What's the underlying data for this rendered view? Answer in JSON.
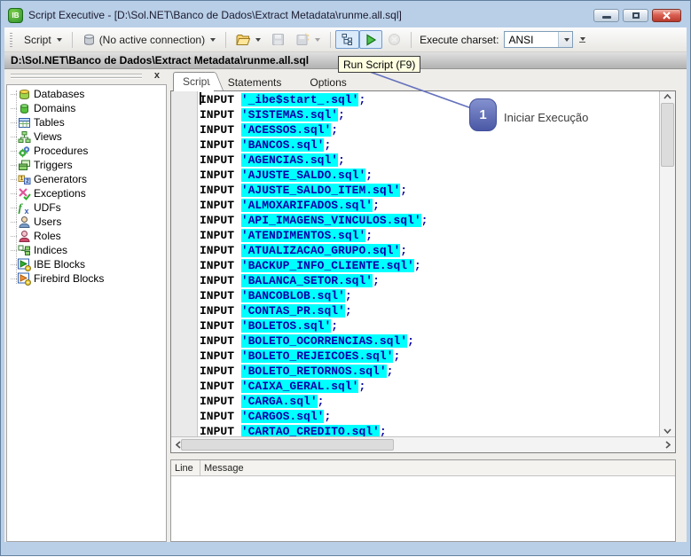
{
  "window": {
    "title": "Script Executive - [D:\\Sol.NET\\Banco de Dados\\Extract Metadata\\runme.all.sql]",
    "icon_text": "IB"
  },
  "toolbar": {
    "script_button": "Script",
    "connection": "(No active connection)",
    "execute_charset_label": "Execute charset:",
    "charset_value": "ANSI",
    "run_tooltip": "Run Script (F9)",
    "icons": [
      "database-icon",
      "open-folder-icon",
      "save-icon",
      "save-all-icon",
      "script-structure-icon",
      "run-icon",
      "stop-icon"
    ]
  },
  "pathbar": {
    "path": "D:\\Sol.NET\\Banco de Dados\\Extract Metadata\\runme.all.sql"
  },
  "sidebar": {
    "items": [
      {
        "label": "Databases",
        "icon": "databases-icon"
      },
      {
        "label": "Domains",
        "icon": "domain-icon"
      },
      {
        "label": "Tables",
        "icon": "table-icon"
      },
      {
        "label": "Views",
        "icon": "view-icon"
      },
      {
        "label": "Procedures",
        "icon": "procedure-gear-icon"
      },
      {
        "label": "Triggers",
        "icon": "trigger-icon"
      },
      {
        "label": "Generators",
        "icon": "generator-icon"
      },
      {
        "label": "Exceptions",
        "icon": "exception-icon"
      },
      {
        "label": "UDFs",
        "icon": "udf-fx-icon"
      },
      {
        "label": "Users",
        "icon": "user-icon"
      },
      {
        "label": "Roles",
        "icon": "role-icon"
      },
      {
        "label": "Indices",
        "icon": "index-icon"
      },
      {
        "label": "IBE Blocks",
        "icon": "ibe-block-icon"
      },
      {
        "label": "Firebird Blocks",
        "icon": "firebird-block-icon"
      }
    ]
  },
  "tabs": [
    {
      "label": "Script",
      "active": true
    },
    {
      "label": "Statements",
      "active": false
    },
    {
      "label": "Options",
      "active": false
    }
  ],
  "editor": {
    "keyword": "INPUT",
    "terminator": ";",
    "lines": [
      "'_ibe$start_.sql'",
      "'SISTEMAS.sql'",
      "'ACESSOS.sql'",
      "'BANCOS.sql'",
      "'AGENCIAS.sql'",
      "'AJUSTE_SALDO.sql'",
      "'AJUSTE_SALDO_ITEM.sql'",
      "'ALMOXARIFADOS.sql'",
      "'API_IMAGENS_VINCULOS.sql'",
      "'ATENDIMENTOS.sql'",
      "'ATUALIZACAO_GRUPO.sql'",
      "'BACKUP_INFO_CLIENTE.sql'",
      "'BALANCA_SETOR.sql'",
      "'BANCOBLOB.sql'",
      "'CONTAS_PR.sql'",
      "'BOLETOS.sql'",
      "'BOLETO_OCORRENCIAS.sql'",
      "'BOLETO_REJEICOES.sql'",
      "'BOLETO_RETORNOS.sql'",
      "'CAIXA_GERAL.sql'",
      "'CARGA.sql'",
      "'CARGOS.sql'",
      "'CARTAO_CREDITO.sql'"
    ]
  },
  "messages": {
    "columns": [
      "Line",
      "Message"
    ]
  },
  "annotation": {
    "step": "1",
    "label": "Iniciar Execução"
  },
  "colors": {
    "string_highlight": "#00ffff",
    "string_text": "#0000a8",
    "annotation_badge": "#4a58a5",
    "tooltip_bg": "#ffffe1",
    "titlebar_frame": "#b9cfe8",
    "close_button": "#c0392b"
  }
}
